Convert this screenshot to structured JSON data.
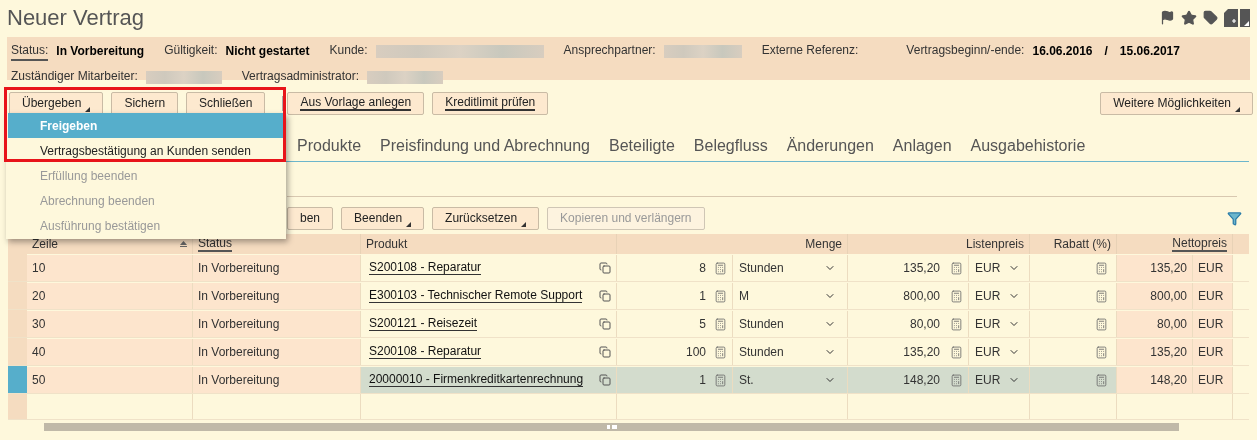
{
  "title": "Neuer Vertrag",
  "info_fields": [
    {
      "label": "Status:",
      "kind": "bold",
      "value": "In Vorbereitung",
      "link": true
    },
    {
      "label": "Gültigkeit:",
      "kind": "bold",
      "value": "Nicht gestartet",
      "link": false
    },
    {
      "label": "Kunde:",
      "kind": "redacted",
      "link": false
    },
    {
      "label": "Ansprechpartner:",
      "kind": "redacted",
      "link": false
    },
    {
      "label": "Externe Referenz:",
      "kind": "empty",
      "link": false
    },
    {
      "label": "Vertragsbeginn/-ende:",
      "kind": "range",
      "values": [
        "16.06.2016",
        "/",
        "15.06.2017"
      ],
      "link": false
    },
    {
      "label": "Zuständiger Mitarbeiter:",
      "kind": "redacted",
      "link": false
    },
    {
      "label": "Vertragsadministrator:",
      "kind": "redacted",
      "link": false
    }
  ],
  "toolbar": [
    {
      "label": "Übergeben",
      "menu": true,
      "underlined": false
    },
    {
      "label": "Sichern",
      "menu": false,
      "underlined": false
    },
    {
      "label": "Schließen",
      "menu": false,
      "underlined": false
    },
    {
      "label": "Aus Vorlage anlegen",
      "menu": false,
      "underlined": true
    },
    {
      "label": "Kreditlimit prüfen",
      "menu": false,
      "underlined": true
    }
  ],
  "more_button": {
    "label": "Weitere Möglichkeiten",
    "menu": true
  },
  "menu": [
    {
      "label": "Freigeben",
      "selected": true,
      "disabled": false
    },
    {
      "label": "Vertragsbestätigung an Kunden senden",
      "selected": false,
      "disabled": false
    },
    {
      "label": "Erfüllung beenden",
      "selected": false,
      "disabled": true
    },
    {
      "label": "Abrechnung beenden",
      "selected": false,
      "disabled": true
    },
    {
      "label": "Ausführung bestätigen",
      "selected": false,
      "disabled": true
    }
  ],
  "tabs": [
    {
      "label": "Produkte"
    },
    {
      "label": "Preisfindung und Abrechnung"
    },
    {
      "label": "Beteiligte"
    },
    {
      "label": "Belegfluss"
    },
    {
      "label": "Änderungen"
    },
    {
      "label": "Anlagen"
    },
    {
      "label": "Ausgabehistorie"
    }
  ],
  "table_toolbar": [
    {
      "label": "ben",
      "menu": false,
      "disabled": false
    },
    {
      "label": "Beenden",
      "menu": true,
      "disabled": false
    },
    {
      "label": "Zurücksetzen",
      "menu": true,
      "disabled": false
    },
    {
      "label": "Kopieren und verlängern",
      "menu": false,
      "disabled": true
    }
  ],
  "table": {
    "columns": [
      {
        "label": "Zeile",
        "sorted": true,
        "underlined": false
      },
      {
        "label": "Status",
        "sorted": false,
        "underlined": true
      },
      {
        "label": "Produkt",
        "sorted": false,
        "underlined": false
      },
      {
        "label": "Menge",
        "sorted": false,
        "underlined": false
      },
      {
        "label": "Listenpreis",
        "sorted": false,
        "underlined": false
      },
      {
        "label": "Rabatt (%)",
        "sorted": false,
        "underlined": false
      },
      {
        "label": "Nettopreis",
        "sorted": false,
        "underlined": true
      }
    ],
    "rows": [
      {
        "selected": false,
        "line": "10",
        "status": "In Vorbereitung",
        "product": "S200108 - Reparatur",
        "qty": "8",
        "unit": "Stunden",
        "list_price": "135,20",
        "list_currency": "EUR",
        "net_price": "135,20",
        "net_currency": "EUR"
      },
      {
        "selected": false,
        "line": "20",
        "status": "In Vorbereitung",
        "product": "E300103 - Technischer Remote Support",
        "qty": "1",
        "unit": "M",
        "list_price": "800,00",
        "list_currency": "EUR",
        "net_price": "800,00",
        "net_currency": "EUR"
      },
      {
        "selected": false,
        "line": "30",
        "status": "In Vorbereitung",
        "product": "S200121 - Reisezeit",
        "qty": "5",
        "unit": "Stunden",
        "list_price": "80,00",
        "list_currency": "EUR",
        "net_price": "80,00",
        "net_currency": "EUR"
      },
      {
        "selected": false,
        "line": "40",
        "status": "In Vorbereitung",
        "product": "S200108 - Reparatur",
        "qty": "100",
        "unit": "Stunden",
        "list_price": "135,20",
        "list_currency": "EUR",
        "net_price": "135,20",
        "net_currency": "EUR"
      },
      {
        "selected": true,
        "line": "50",
        "status": "In Vorbereitung",
        "product": "20000010 - Firmenkreditkartenrechnung",
        "qty": "1",
        "unit": "St.",
        "list_price": "148,20",
        "list_currency": "EUR",
        "net_price": "148,20",
        "net_currency": "EUR"
      }
    ]
  }
}
